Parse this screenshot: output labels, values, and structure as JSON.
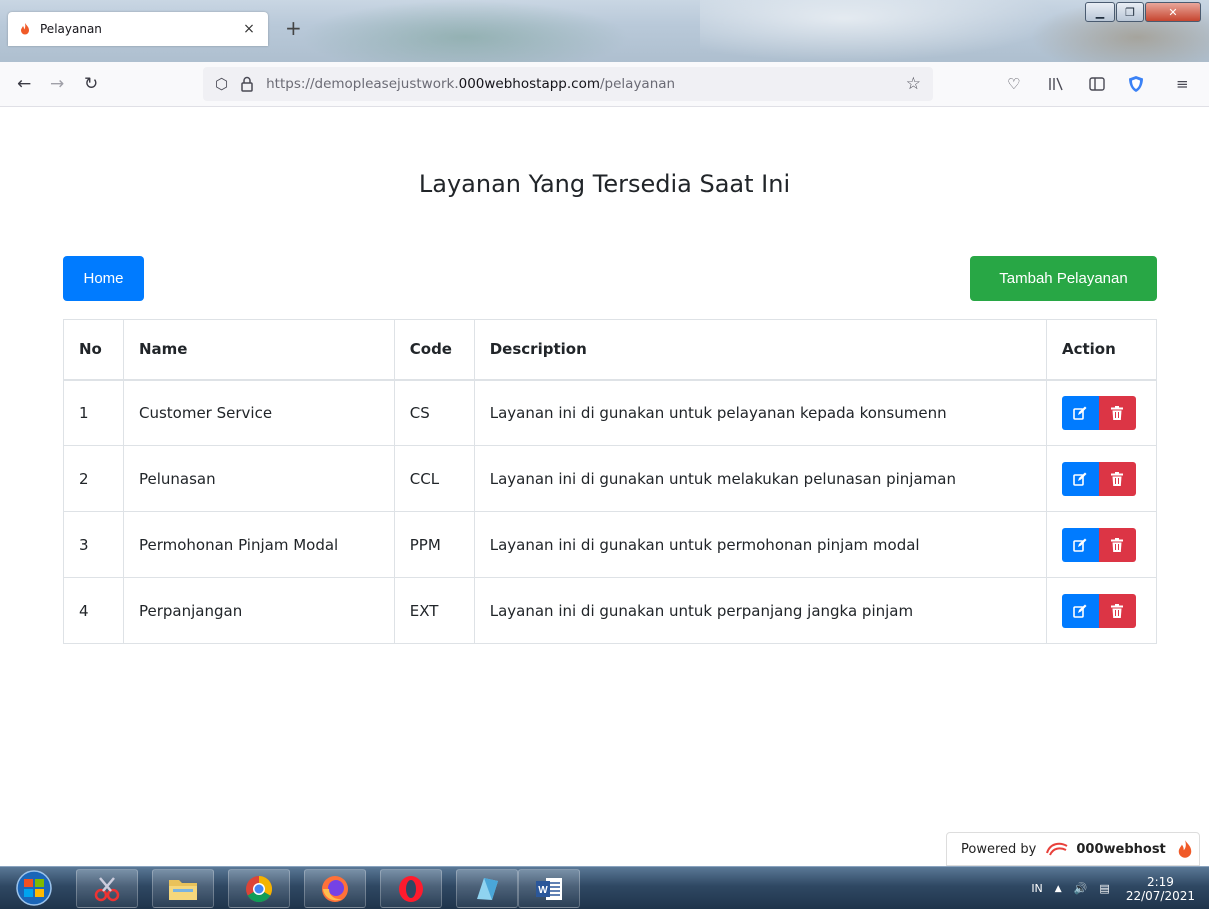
{
  "browser": {
    "tab_title": "Pelayanan",
    "tab_close": "×",
    "new_tab": "+",
    "url_prefix": "https://demopleasejustwork.",
    "url_host": "000webhostapp.com",
    "url_path": "/pelayanan",
    "icons": [
      "back-arrow-icon",
      "forward-arrow-icon",
      "reload-icon",
      "shield-icon",
      "lock-icon",
      "star-icon",
      "pocket-icon",
      "library-icon",
      "reader-view-icon",
      "privacy-badger-icon",
      "hamburger-menu-icon"
    ]
  },
  "page": {
    "title": "Layanan Yang Tersedia Saat Ini",
    "home_label": "Home",
    "add_label": "Tambah Pelayanan",
    "columns": [
      "No",
      "Name",
      "Code",
      "Description",
      "Action"
    ],
    "rows": [
      {
        "no": "1",
        "name": "Customer Service",
        "code": "CS",
        "description": "Layanan ini di gunakan untuk pelayanan kepada konsumenn"
      },
      {
        "no": "2",
        "name": "Pelunasan",
        "code": "CCL",
        "description": "Layanan ini di gunakan untuk melakukan pelunasan pinjaman"
      },
      {
        "no": "3",
        "name": "Permohonan Pinjam Modal",
        "code": "PPM",
        "description": "Layanan ini di gunakan untuk permohonan pinjam modal"
      },
      {
        "no": "4",
        "name": "Perpanjangan",
        "code": "EXT",
        "description": "Layanan ini di gunakan untuk perpanjang jangka pinjam"
      }
    ],
    "colors": {
      "primary": "#007bff",
      "success": "#28a745",
      "danger": "#dc3545"
    }
  },
  "footer": {
    "powered_by": "Powered by",
    "brand": "000webhost"
  },
  "taskbar": {
    "lang": "IN",
    "tray_arrow": "▲",
    "time": "2:19",
    "date": "22/07/2021",
    "apps": [
      "snipping-tool-icon",
      "file-explorer-icon",
      "chrome-icon",
      "firefox-icon",
      "opera-icon",
      "app-icon",
      "word-icon"
    ]
  }
}
